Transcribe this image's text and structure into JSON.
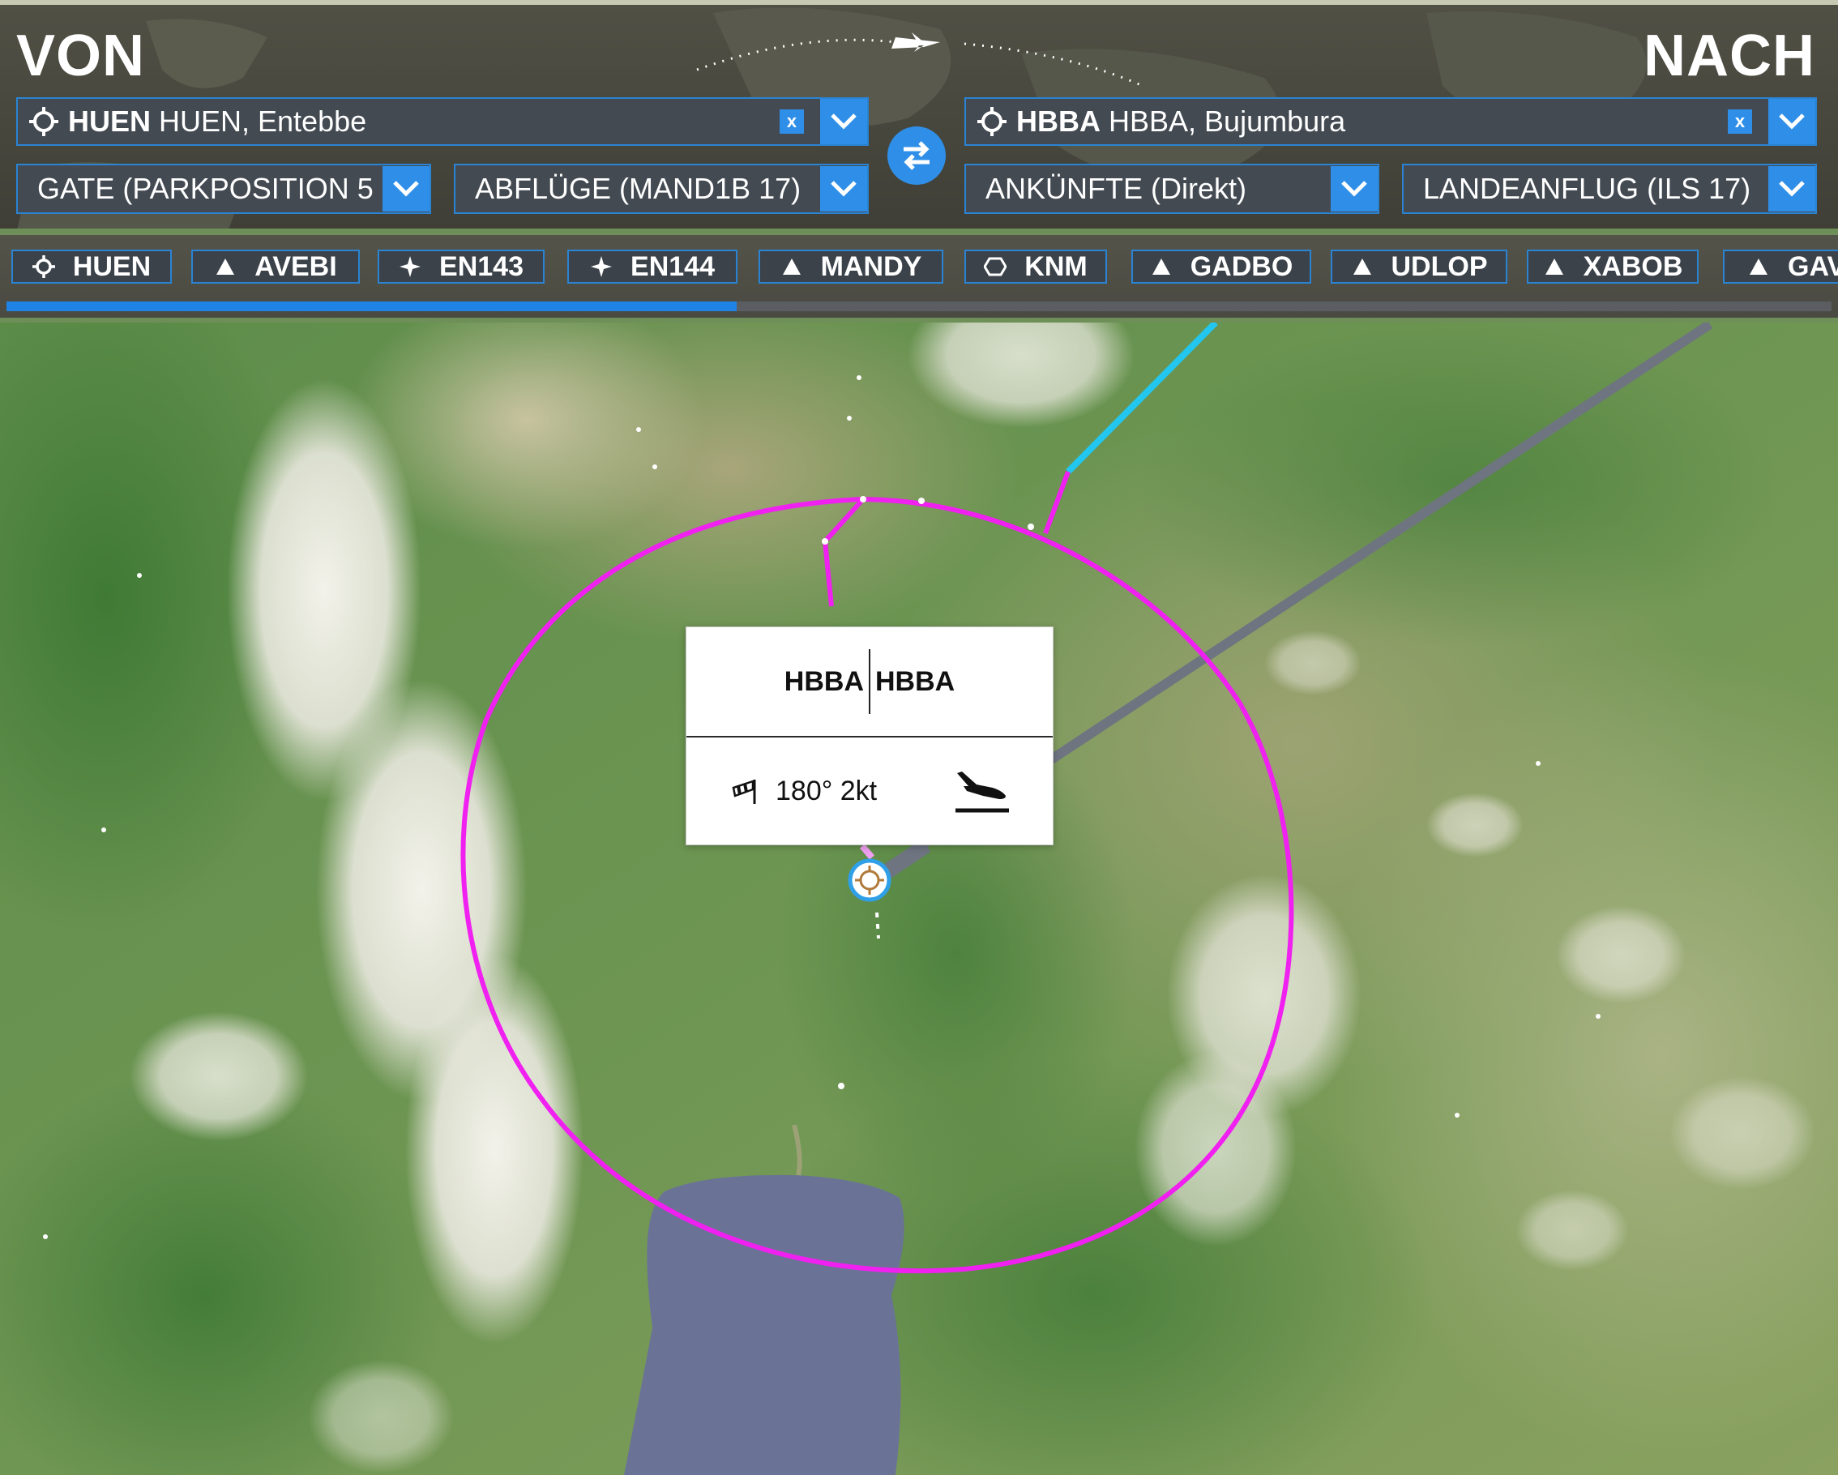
{
  "header": {
    "from_title": "VON",
    "to_title": "NACH",
    "departure": {
      "code": "HUEN",
      "name": "HUEN, Entebbe",
      "clear_label": "x"
    },
    "arrival": {
      "code": "HBBA",
      "name": "HBBA, Bujumbura",
      "clear_label": "x"
    },
    "departure_gate": "GATE (PARKPOSITION 5",
    "departure_procedure": "ABFLÜGE (MAND1B 17)",
    "arrival_procedure": "ANKÜNFTE (Direkt)",
    "approach": "LANDEANFLUG (ILS 17)"
  },
  "waypoints": [
    {
      "label": "HUEN",
      "icon": "airport-icon"
    },
    {
      "label": "AVEBI",
      "icon": "triangle-waypoint-icon"
    },
    {
      "label": "EN143",
      "icon": "star-waypoint-icon"
    },
    {
      "label": "EN144",
      "icon": "star-waypoint-icon"
    },
    {
      "label": "MANDY",
      "icon": "triangle-waypoint-icon"
    },
    {
      "label": "KNM",
      "icon": "vor-icon"
    },
    {
      "label": "GADBO",
      "icon": "triangle-waypoint-icon"
    },
    {
      "label": "UDLOP",
      "icon": "triangle-waypoint-icon"
    },
    {
      "label": "XABOB",
      "icon": "triangle-waypoint-icon"
    },
    {
      "label": "GAV",
      "icon": "triangle-waypoint-icon"
    }
  ],
  "route_progress": 0.4,
  "popup": {
    "code_left": "HBBA",
    "code_right": "HBBA",
    "wind": "180° 2kt"
  },
  "colors": {
    "accent": "#2f8fe8",
    "route_magenta": "#f020f0",
    "route_cyan": "#22c6ee",
    "route_gray": "#6e7480",
    "lake": "#6a7396"
  }
}
